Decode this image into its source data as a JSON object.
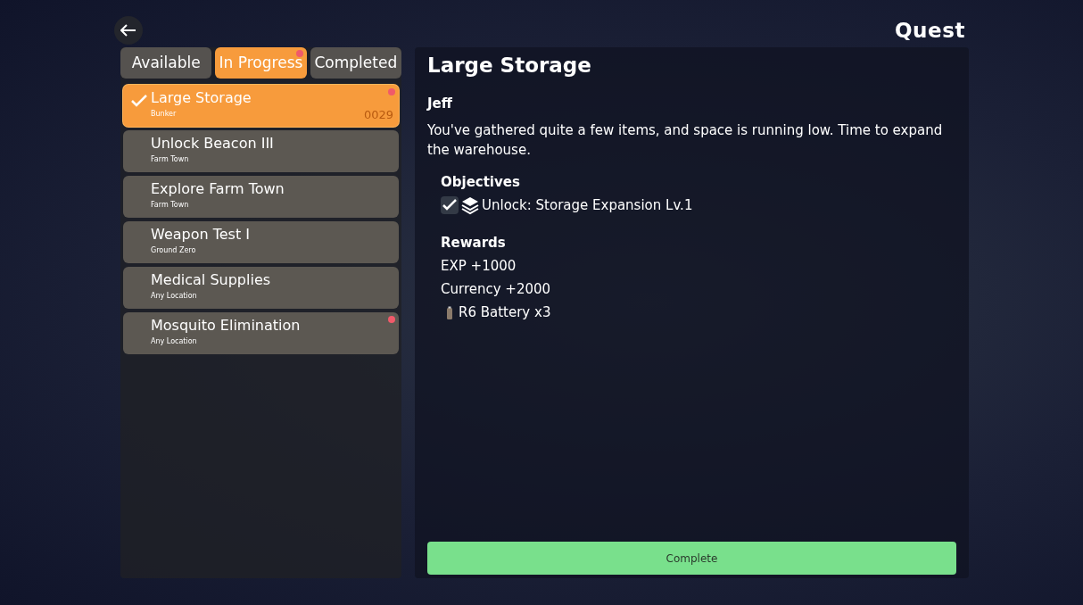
{
  "header": {
    "title": "Quest"
  },
  "tabs": [
    {
      "label": "Available",
      "selected": false,
      "new": false
    },
    {
      "label": "In Progress",
      "selected": true,
      "new": true
    },
    {
      "label": "Completed",
      "selected": false,
      "new": false
    }
  ],
  "quests": [
    {
      "title": "Large Storage",
      "location": "Bunker",
      "code": "0029",
      "selected": true,
      "done": true,
      "new": true
    },
    {
      "title": "Unlock Beacon III",
      "location": "Farm Town",
      "selected": false,
      "done": false,
      "new": false
    },
    {
      "title": "Explore Farm Town",
      "location": "Farm Town",
      "selected": false,
      "done": false,
      "new": false
    },
    {
      "title": "Weapon Test I",
      "location": "Ground Zero",
      "selected": false,
      "done": false,
      "new": false
    },
    {
      "title": "Medical Supplies",
      "location": "Any Location",
      "selected": false,
      "done": false,
      "new": false
    },
    {
      "title": "Mosquito Elimination",
      "location": "Any Location",
      "selected": false,
      "done": false,
      "new": true
    }
  ],
  "detail": {
    "title": "Large Storage",
    "giver": "Jeff",
    "description": "You've gathered quite a few items, and space is running low. Time to expand the warehouse.",
    "objectives_heading": "Objectives",
    "objectives": [
      {
        "label": "Unlock: Storage Expansion Lv.1",
        "checked": true
      }
    ],
    "rewards_heading": "Rewards",
    "rewards": [
      {
        "kind": "stat",
        "label": "EXP +1000"
      },
      {
        "kind": "stat",
        "label": "Currency +2000"
      },
      {
        "kind": "item",
        "label": "R6 Battery x3"
      }
    ],
    "button": "Complete"
  }
}
